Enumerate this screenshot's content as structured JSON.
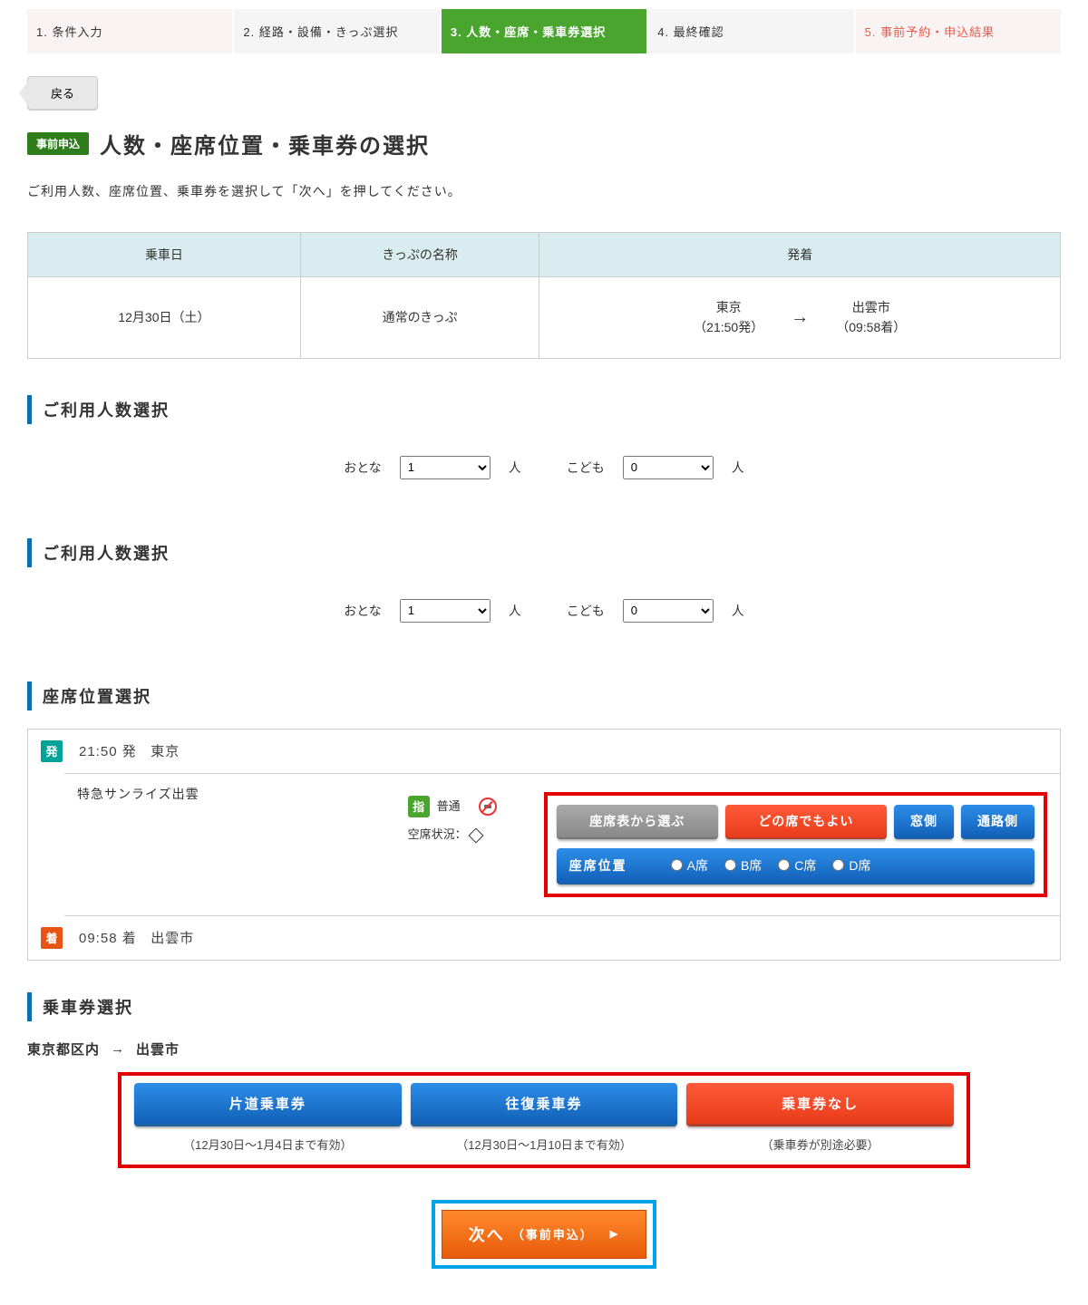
{
  "steps": {
    "s1": "1. 条件入力",
    "s2": "2. 経路・設備・きっぷ選択",
    "s3": "3. 人数・座席・乗車券選択",
    "s4": "4. 最終確認",
    "s5": "5. 事前予約・申込結果"
  },
  "back": "戻る",
  "badge": "事前申込",
  "title": "人数・座席位置・乗車券の選択",
  "instruction": "ご利用人数、座席位置、乗車券を選択して「次へ」を押してください。",
  "table": {
    "h1": "乗車日",
    "h2": "きっぷの名称",
    "h3": "発着",
    "date": "12月30日（土）",
    "ticket": "通常のきっぷ",
    "from": "東京",
    "from_time": "（21:50発）",
    "to": "出雲市",
    "to_time": "（09:58着）"
  },
  "sec_count": "ご利用人数選択",
  "count": {
    "adult_label": "おとな",
    "adult_val": "1",
    "child_label": "こども",
    "child_val": "0",
    "unit": "人"
  },
  "sec_seat": "座席位置選択",
  "seat": {
    "dep_badge": "発",
    "dep_time": "21:50 発",
    "dep_st": "東京",
    "arr_badge": "着",
    "arr_time": "09:58 着",
    "arr_st": "出雲市",
    "train": "特急サンライズ出雲",
    "resv_icon": "指",
    "class": "普通",
    "vacancy_label": "空席状況：",
    "btn_chart": "座席表から選ぶ",
    "btn_any": "どの席でもよい",
    "btn_window": "窓側",
    "btn_aisle": "通路側",
    "pos_label": "座席位置",
    "optA": "A席",
    "optB": "B席",
    "optC": "C席",
    "optD": "D席"
  },
  "sec_ticket": "乗車券選択",
  "route": {
    "from": "東京都区内",
    "to": "出雲市"
  },
  "tickets": {
    "oneway": "片道乗車券",
    "oneway_note": "（12月30日〜1月4日まで有効）",
    "round": "往復乗車券",
    "round_note": "（12月30日〜1月10日まで有効）",
    "none": "乗車券なし",
    "none_note": "（乗車券が別途必要）"
  },
  "next": {
    "label": "次へ",
    "sub": "（事前申込）"
  }
}
